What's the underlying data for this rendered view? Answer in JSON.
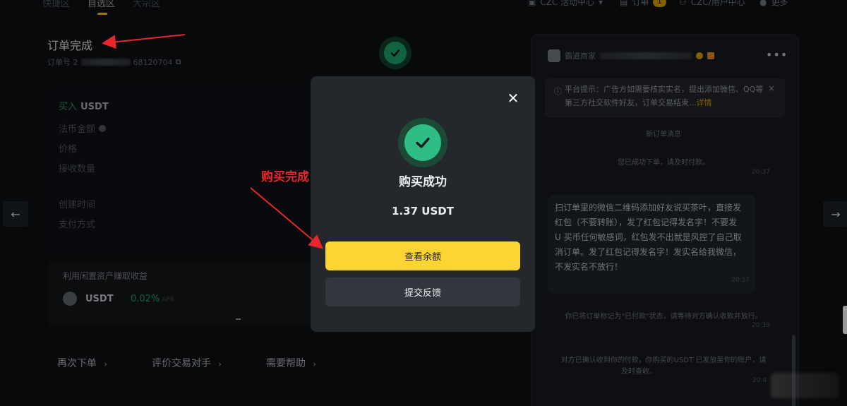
{
  "nav": {
    "tabs": [
      "快捷区",
      "自选区",
      "大宗区"
    ],
    "right_items": [
      {
        "label": "CZC 活动中心",
        "icon": "gift-icon"
      },
      {
        "label": "订单",
        "badge": "1",
        "icon": "orders-icon"
      },
      {
        "label": "CZC/用户中心",
        "icon": "user-icon"
      },
      {
        "label": "更多",
        "icon": "more-icon"
      }
    ]
  },
  "order": {
    "title": "订单完成",
    "number_prefix": "订单号 2",
    "number_suffix": "68120704"
  },
  "details": {
    "buy_label": "买入",
    "buy_asset": "USDT",
    "fiat_amount_label": "法币金额",
    "price_label": "价格",
    "received_qty_label": "接收数量",
    "created_time_label": "创建时间",
    "payment_method_label": "支付方式"
  },
  "earn": {
    "title": "利用闲置资产赚取收益",
    "asset": "USDT",
    "rate": "0.02%",
    "rate_suffix": "APR"
  },
  "bottom_links": [
    "再次下单",
    "评价交易对手",
    "需要帮助"
  ],
  "chat": {
    "merchant_name": "霸道商家",
    "notice_text": "平台提示：广告方如需要核实实名，提出添加微信、QQ等第三方社交软件好友，订单交易结束...",
    "notice_link": "详情",
    "system_new_order": "新订单消息",
    "sys_order_created": "您已成功下单，请及时付款。",
    "time_1": "20:37",
    "bubble_lines": [
      "扫订单里的微信二维码添加好友说买茶叶，直接发",
      "红包（不要转账），发了红包记得发名字！不要发",
      "U 买币任何敏感词，红包发不出就是风控了自己取",
      "消订单。发了红包记得发名字！发实名给我微信，",
      "不发实名不放行！"
    ],
    "time_2": "20:37",
    "sys_marked_paid": "你已将订单标记为\"已付款\"状态，请等待对方确认收款并放行。",
    "time_3": "20:39",
    "sys_released_1": "对方已确认收到你的付款，你购买的USDT 已发放至你的账户，请",
    "sys_released_2": "及时查收。",
    "time_4": "20:4"
  },
  "modal": {
    "title": "购买成功",
    "amount": "1.37 USDT",
    "primary_label": "查看余额",
    "secondary_label": "提交反馈"
  },
  "annotations": {
    "purchase_done": "购买完成"
  },
  "colors": {
    "primary_yellow": "#fcd535",
    "success_green": "#2ebd85",
    "annotation_red": "#e8262b"
  }
}
